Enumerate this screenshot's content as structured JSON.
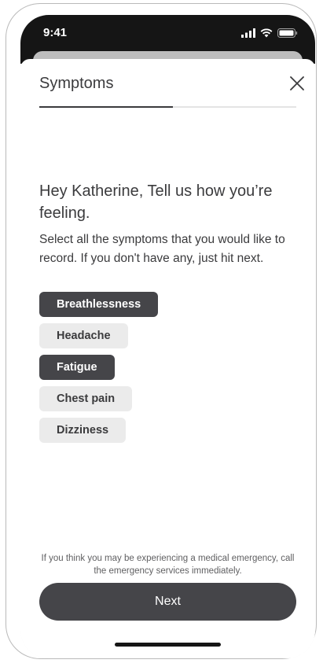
{
  "status_bar": {
    "time": "9:41",
    "icons": [
      "cellular-signal-icon",
      "wifi-icon",
      "battery-icon"
    ]
  },
  "header": {
    "title": "Symptoms",
    "close_icon": "close-icon",
    "progress": 0.52
  },
  "content": {
    "heading": "Hey Katherine, Tell us how you’re feeling.",
    "subtitle": "Select all the symptoms that you would like to record. If you don't have any, just hit next."
  },
  "symptoms": [
    {
      "label": "Breathlessness",
      "selected": true
    },
    {
      "label": "Headache",
      "selected": false
    },
    {
      "label": "Fatigue",
      "selected": true
    },
    {
      "label": "Chest pain",
      "selected": false
    },
    {
      "label": "Dizziness",
      "selected": false
    }
  ],
  "footer": {
    "disclaimer": "If you think you may be experiencing a medical emergency, call the emergency services immediately.",
    "next_label": "Next"
  },
  "colors": {
    "selected_chip": "#454549",
    "unselected_chip": "#ebebeb",
    "text": "#3b3b3d"
  }
}
